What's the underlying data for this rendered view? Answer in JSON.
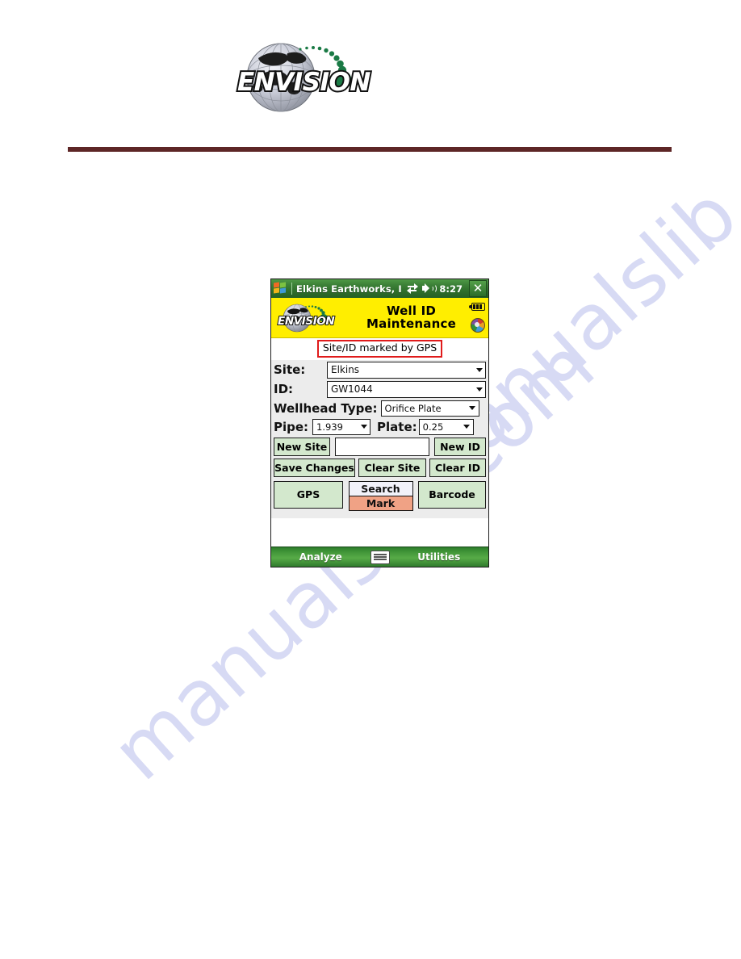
{
  "page": {
    "logo_text": "ENVISION",
    "watermark_line_1": "manualslib.com",
    "watermark_line_2": "manualslib.com"
  },
  "device": {
    "titlebar": {
      "app_title": "Elkins Earthworks, I",
      "time": "8:27",
      "close_label": "✕",
      "icons": [
        "windows-flag-icon",
        "connectivity-icon",
        "speaker-icon"
      ]
    },
    "appheader": {
      "logo_text": "ENVISION",
      "title_line_1": "Well ID",
      "title_line_2": "Maintenance",
      "status_icons": [
        "battery-icon",
        "satellite-status-icon"
      ]
    },
    "notice": {
      "text": "Site/ID marked by GPS",
      "border_color": "#e01b1b"
    },
    "form": {
      "site_label": "Site:",
      "site_value": "Elkins",
      "id_label": "ID:",
      "id_value": "GW1044",
      "wellhead_label": "Wellhead Type:",
      "wellhead_value": "Orifice Plate",
      "pipe_label": "Pipe:",
      "pipe_value": "1.939",
      "plate_label": "Plate:",
      "plate_value": "0.25",
      "new_site_label": "New Site",
      "new_entry_value": "",
      "new_entry_placeholder": "",
      "new_id_label": "New ID",
      "save_changes_label": "Save Changes",
      "clear_site_label": "Clear Site",
      "clear_id_label": "Clear ID"
    },
    "actions": {
      "gps_label": "GPS",
      "search_label": "Search",
      "mark_label": "Mark",
      "barcode_label": "Barcode",
      "mark_active_color": "#f0a285"
    },
    "bottombar": {
      "left_label": "Analyze",
      "keyboard_icon": "keyboard-icon",
      "right_label": "Utilities"
    }
  }
}
